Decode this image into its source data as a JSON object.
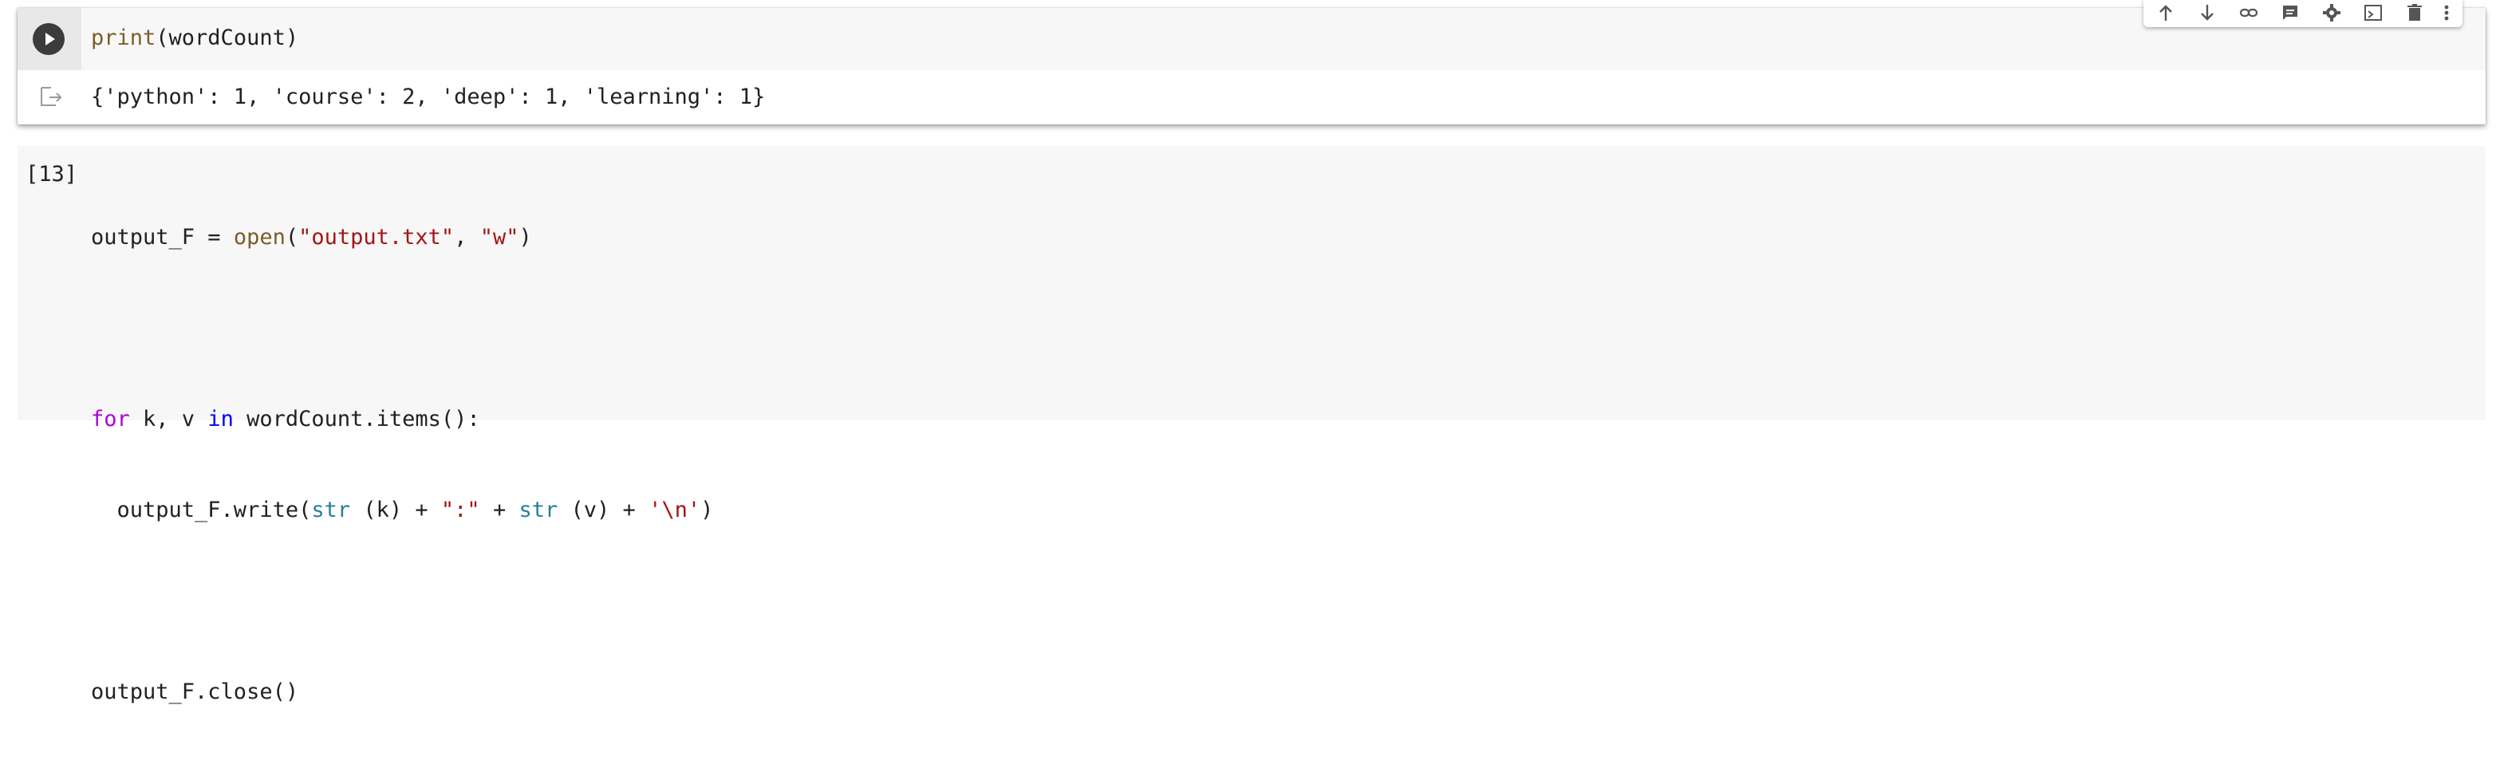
{
  "cell1": {
    "code": {
      "fn": "print",
      "rest": "(wordCount)"
    },
    "output": "{'python': 1, 'course': 2, 'deep': 1, 'learning': 1}"
  },
  "toolbar": {
    "icons": [
      "arrow-up-icon",
      "arrow-down-icon",
      "link-icon",
      "comment-icon",
      "gear-icon",
      "mirror-cell-icon",
      "delete-icon",
      "more-vert-icon"
    ]
  },
  "cell2": {
    "exec_count": "[13]",
    "line1": {
      "a": "output_F = ",
      "fn": "open",
      "b": "(",
      "s1": "\"output.txt\"",
      "c": ", ",
      "s2": "\"w\"",
      "d": ")"
    },
    "line2": {
      "kw": "for",
      "a": " k, v ",
      "kw2": "in",
      "b": " wordCount.items():"
    },
    "line3": {
      "a": "  output_F.write(",
      "bi1": "str",
      "b": " (k) + ",
      "s": "\":\"",
      "c": " + ",
      "bi2": "str",
      "d": " (v) + ",
      "s2": "'\\n'",
      "e": ")"
    },
    "line4": {
      "a": "output_F.close()"
    }
  },
  "colors": {
    "function": "#795e26",
    "string": "#a31515",
    "keyword": "#af00db",
    "keyword_in": "#0000ff",
    "builtin": "#267f99",
    "cell_bg": "#f7f7f7"
  }
}
